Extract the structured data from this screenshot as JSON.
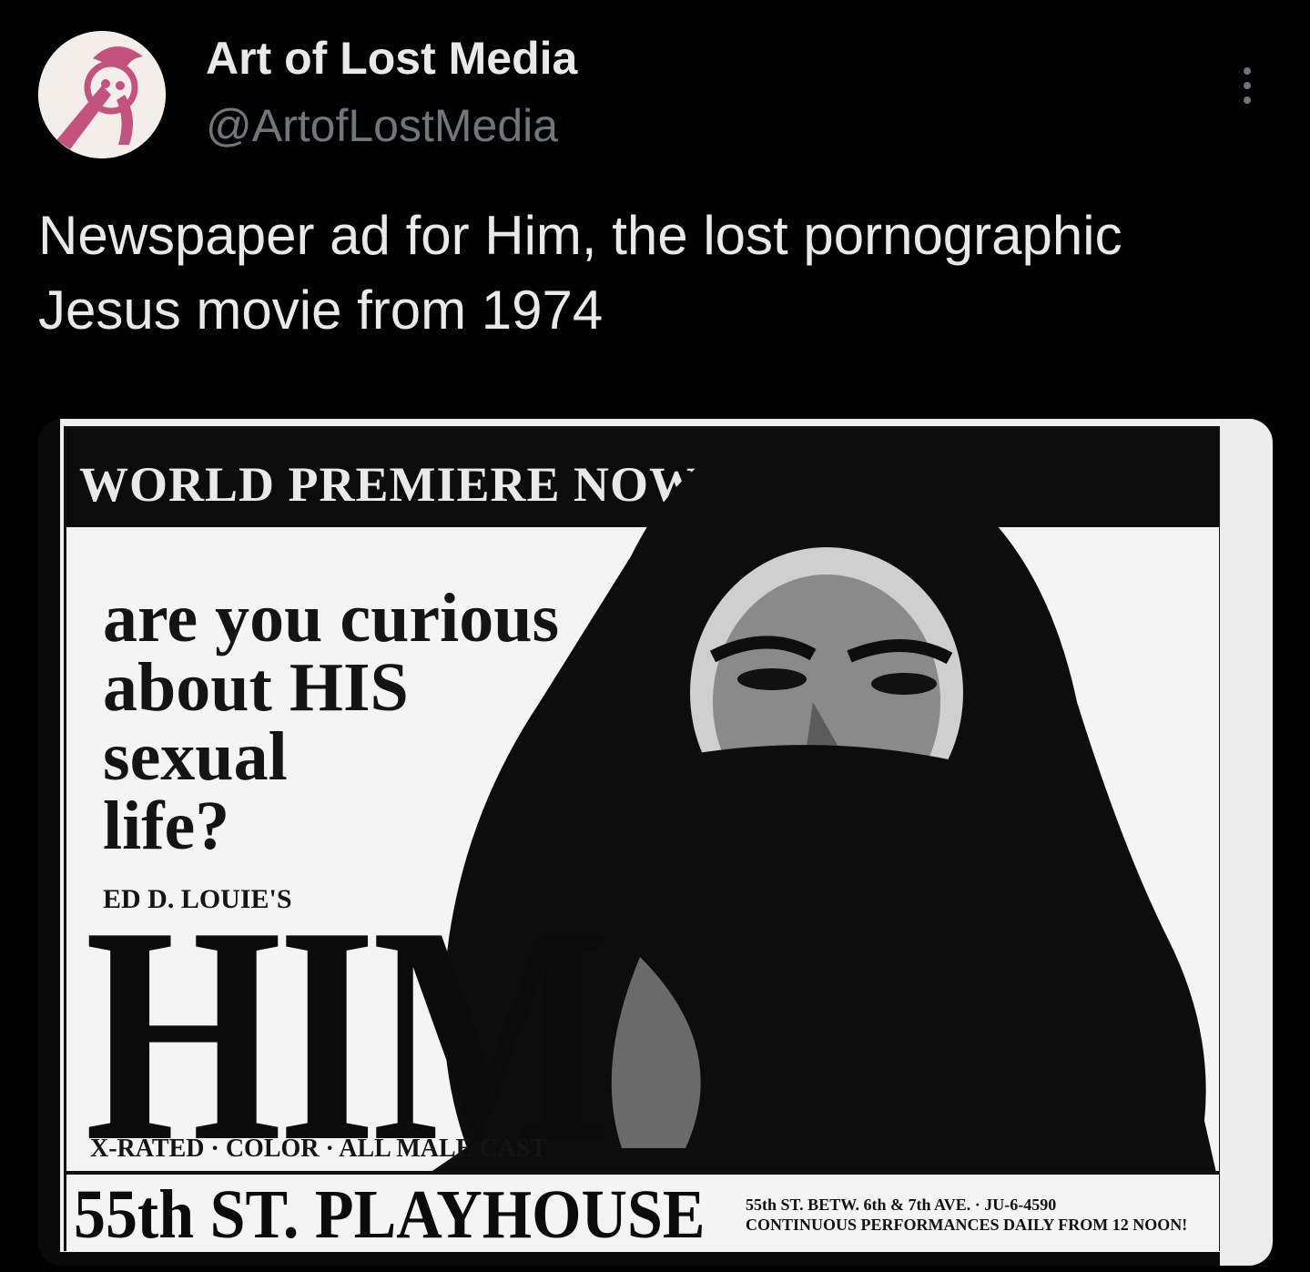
{
  "author": {
    "display_name": "Art of Lost Media",
    "handle": "@ArtofLostMedia",
    "avatar_icon": "cartoon-character-avatar",
    "avatar_color": "#c4527f"
  },
  "tweet": {
    "text": "Newspaper ad for Him, the lost pornographic Jesus movie from 1974"
  },
  "more_icon": "more-options-icon",
  "ad": {
    "banner": "WORLD PREMIERE NOW!",
    "headline_lines": [
      "are you curious",
      "about HIS",
      "sexual",
      "life?"
    ],
    "presenter": "ED D. LOUIE'S",
    "title": "HIM",
    "tagline": "X-RATED · COLOR · ALL MALE CAST",
    "theater": "55th ST. PLAYHOUSE",
    "address": "55th ST. BETW. 6th & 7th AVE. · JU-6-4590",
    "schedule": "CONTINUOUS PERFORMANCES DAILY FROM 12 NOON!"
  }
}
